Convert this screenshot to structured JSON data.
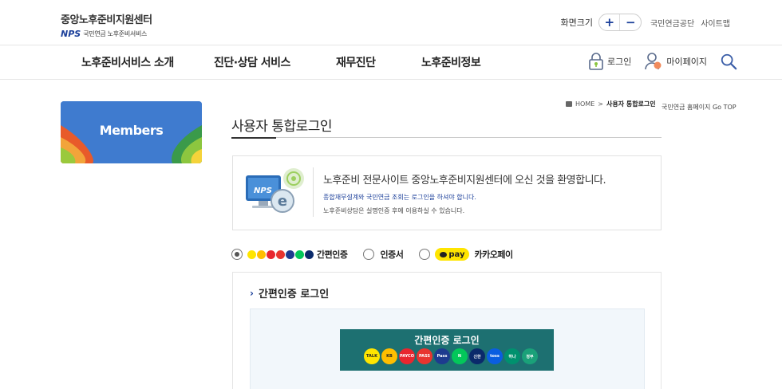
{
  "header": {
    "logo_title": "중앙노후준비지원센터",
    "logo_nps": "NPS",
    "logo_subtitle": "국민연금 노후준비서비스",
    "font_size_label": "화면크기",
    "font_plus": "+",
    "font_minus": "−",
    "util_links": [
      "국민연금공단",
      "사이트맵"
    ]
  },
  "gnb": {
    "items": [
      "노후준비서비스 소개",
      "진단·상담 서비스",
      "재무진단",
      "노후준비정보"
    ],
    "login_label": "로그인",
    "mypage_label": "마이페이지"
  },
  "sidebar": {
    "title": "Members"
  },
  "breadcrumb": {
    "home": "HOME",
    "separator": ">",
    "current": "사용자 통합로그인",
    "home_link": "국민연금 홈페이지 Go TOP"
  },
  "page": {
    "title": "사용자 통합로그인"
  },
  "welcome": {
    "nps_badge": "NPS",
    "main": "노후준비 전문사이트 중앙노후준비지원센터에 오신 것을 환영합니다.",
    "sub1": "종합재무설계와 국민연금 조회는 로그인을 하셔야 합니다.",
    "sub2": "노후준비상담은 실명인증 후에 이용하실 수 있습니다."
  },
  "auth_options": {
    "selected": "easy",
    "easy": "간편인증",
    "cert": "인증서",
    "kakaopay_badge": "pay",
    "kakaopay": "카카오페이"
  },
  "login_panel": {
    "title": "간편인증 로그인",
    "button": "간편인증 로그인"
  },
  "providers": [
    {
      "name": "kakao",
      "color": "#ffe500",
      "text": "TALK"
    },
    {
      "name": "kb",
      "color": "#ffbe00",
      "text": "KB"
    },
    {
      "name": "payco",
      "color": "#e8262f",
      "text": "PAYCO"
    },
    {
      "name": "pass",
      "color": "#e8352f",
      "text": "PASS"
    },
    {
      "name": "samsung-pass",
      "color": "#1d3b8f",
      "text": "Pass"
    },
    {
      "name": "naver",
      "color": "#03c75a",
      "text": "N"
    },
    {
      "name": "shinhan",
      "color": "#0a2a6b",
      "text": "신한"
    },
    {
      "name": "toss",
      "color": "#0a5ee0",
      "text": "toss"
    },
    {
      "name": "hana",
      "color": "#00916e",
      "text": "하나"
    },
    {
      "name": "gov",
      "color": "#1aa179",
      "text": "정부"
    }
  ]
}
